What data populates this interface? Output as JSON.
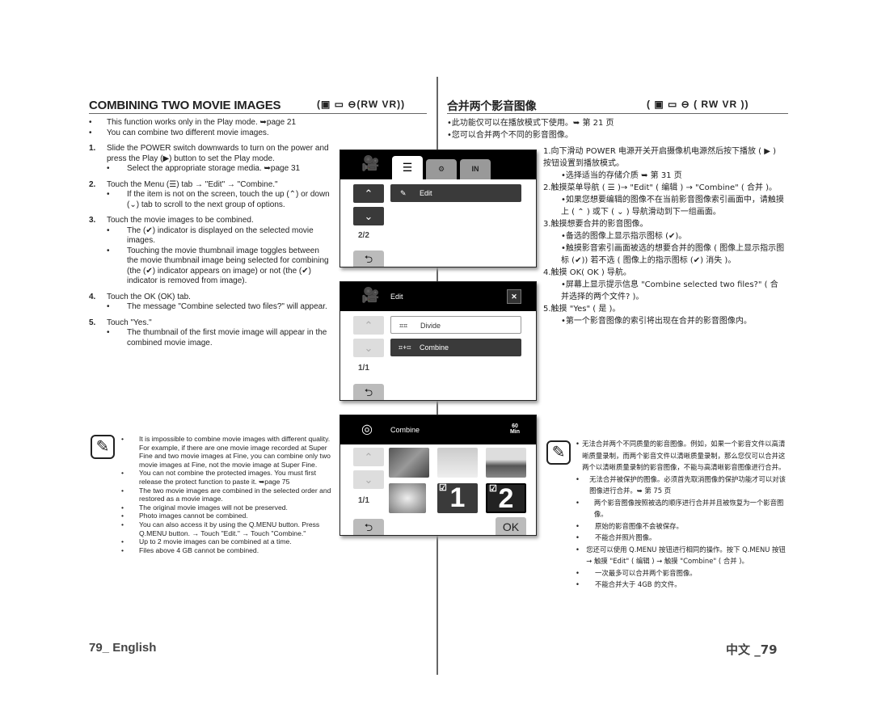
{
  "en": {
    "title": "COMBINING TWO MOVIE IMAGES",
    "modes": "(▣ ▭ ⊖(RW VR))",
    "intro": [
      "This function works only in the Play mode. ➥page 21",
      "You can combine two different movie images."
    ],
    "steps": [
      {
        "num": "1.",
        "text": "Slide the POWER switch downwards to turn on the power and press the Play (▶) button to set the Play mode.",
        "sub": [
          "Select the appropriate storage media. ➥page 31"
        ]
      },
      {
        "num": "2.",
        "text": "Touch the Menu (☰) tab → \"Edit\" → \"Combine.\"",
        "sub": [
          "If the item is not on the screen, touch the up (⌃) or down (⌄) tab to scroll to the next group of options."
        ]
      },
      {
        "num": "3.",
        "text": "Touch the movie images to be combined.",
        "sub": [
          "The (✔) indicator is displayed on the selected movie images.",
          "Touching the movie thumbnail image toggles between the movie thumbnail image being selected for combining (the (✔) indicator appears on image) or not (the (✔) indicator is removed from image)."
        ]
      },
      {
        "num": "4.",
        "text": "Touch the OK (OK) tab.",
        "sub": [
          "The message \"Combine selected two files?\" will appear."
        ]
      },
      {
        "num": "5.",
        "text": "Touch \"Yes.\"",
        "sub": [
          "The thumbnail of the first movie image will appear in the combined movie image."
        ]
      }
    ],
    "notes": [
      "It is impossible to combine movie images with different quality. For example, if there are one movie image recorded at Super Fine and two movie images at Fine, you can combine only two movie images at Fine, not the movie image at Super Fine.",
      "You can not combine the protected images. You must first release the protect function to paste it. ➥page 75",
      "The two movie images are combined in the selected order and restored as a movie image.",
      "The original movie images will not be preserved.",
      "Photo images cannot be combined.",
      "You can also access it by using the Q.MENU button. Press Q.MENU button. → Touch \"Edit.\" → Touch \"Combine.\"",
      "Up to 2 movie images can be combined at a time.",
      "Files above 4 GB cannot be combined."
    ],
    "footer": "79_ English"
  },
  "cn": {
    "title": "合并两个影音图像",
    "modes": "( ▣ ▭ ⊖ ( RW VR ))",
    "intro": [
      "此功能仅可以在播放模式下使用。➥ 第 21 页",
      "您可以合并两个不同的影音图像。"
    ],
    "steps": [
      {
        "num": "1.",
        "text": "向下滑动 POWER 电源开关开启摄像机电源然后按下播放 ( ▶ ) 按钮设置到播放模式。",
        "sub": [
          "选择适当的存储介质 ➥ 第 31 页"
        ]
      },
      {
        "num": "2.",
        "text": "触摸菜单导航 ( ☰ )→ \"Edit\" ( 编辑 ) → \"Combine\" ( 合并 )。",
        "sub": [
          "如果您想要编辑的图像不在当前影音图像索引画面中，请触摸上 ( ⌃ ) 或下 ( ⌄ ) 导航滑动到下一组画面。"
        ]
      },
      {
        "num": "3.",
        "text": "触摸想要合并的影音图像。",
        "sub": [
          "备选的图像上显示指示图标 (✔)。",
          "触摸影音索引画面被选的想要合并的图像 ( 图像上显示指示图标 (✔)) 若不选 ( 图像上的指示图标 (✔) 消失 )。"
        ]
      },
      {
        "num": "4.",
        "text": "触摸 OK( OK ) 导航。",
        "sub": [
          "屏幕上显示提示信息 \"Combine selected two files?\" ( 合并选择的两个文件? )。"
        ]
      },
      {
        "num": "5.",
        "text": "触摸 \"Yes\" ( 是 )。",
        "sub": [
          "第一个影音图像的索引将出现在合并的影音图像内。"
        ]
      }
    ],
    "notes": [
      "无法合并两个不同质量的影音图像。例如，如果一个影音文件以高清晰质量录制，而两个影音文件以清晰质量录制，那么您仅可以合并这两个以清晰质量录制的影音图像，不能与高清晰影音图像进行合并。",
      "无法合并被保护的图像。必须首先取消图像的保护功能才可以对该图像进行合并。➥ 第 75 页",
      "两个影音图像按照被选的顺序进行合并并且被恢复为一个影音图像。",
      "原始的影音图像不会被保存。",
      "不能合并照片图像。",
      "您还可以使用 Q.MENU 按钮进行相同的操作。按下 Q.MENU 按钮 → 触摸 \"Edit\" ( 编辑 ) → 触摸 \"Combine\" ( 合并 )。",
      "一次最多可以合并两个影音图像。",
      "不能合并大于 4GB 的文件。"
    ],
    "footer": "中文 _79"
  },
  "screens": {
    "s1": {
      "menu_item": "Edit",
      "page": "2/2"
    },
    "s2": {
      "title": "Edit",
      "items": [
        "Divide",
        "Combine"
      ],
      "page": "1/1"
    },
    "s3": {
      "title": "Combine",
      "remaining": "60 Min",
      "page": "1/1",
      "ok": "OK",
      "selected": [
        "1",
        "2"
      ]
    }
  },
  "icons": {
    "bullet": "•",
    "note": "note-pencil-icon",
    "up": "⌃",
    "down": "⌄",
    "back": "⮌",
    "close": "✕",
    "camera": "movie-camera-icon"
  }
}
